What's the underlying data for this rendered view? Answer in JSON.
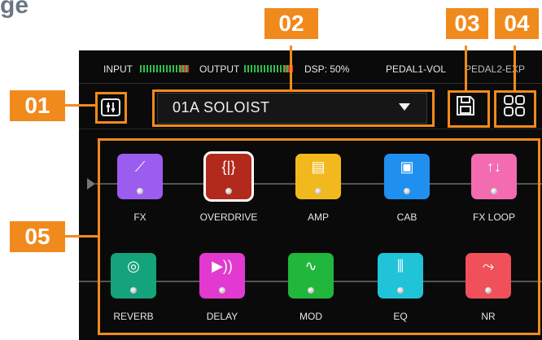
{
  "header_fragment": "ge",
  "status": {
    "input_label": "INPUT",
    "output_label": "OUTPUT",
    "dsp": "DSP: 50%",
    "pedal1": "PEDAL1-VOL",
    "pedal2": "PEDAL2-EXP"
  },
  "preset": {
    "name": "01A  SOLOIST"
  },
  "callouts": [
    "01",
    "02",
    "03",
    "04",
    "05"
  ],
  "pedals_row1": [
    {
      "label": "FX",
      "color": "#9b5cf0",
      "symbol": "⟋"
    },
    {
      "label": "OVERDRIVE",
      "color": "#b22a1c",
      "symbol": "{|}"
    },
    {
      "label": "AMP",
      "color": "#f2b91e",
      "symbol": "▤"
    },
    {
      "label": "CAB",
      "color": "#1f8ff0",
      "symbol": "▣"
    },
    {
      "label": "FX LOOP",
      "color": "#f36bb0",
      "symbol": "↑↓"
    }
  ],
  "pedals_row2": [
    {
      "label": "REVERB",
      "color": "#15a37c",
      "symbol": "◎"
    },
    {
      "label": "DELAY",
      "color": "#e23ad0",
      "symbol": "▶))"
    },
    {
      "label": "MOD",
      "color": "#21b63c",
      "symbol": "∿"
    },
    {
      "label": "EQ",
      "color": "#20c3d8",
      "symbol": "⫼"
    },
    {
      "label": "NR",
      "color": "#f0505a",
      "symbol": "⤳"
    }
  ],
  "colors": {
    "accent": "#f18a1c",
    "screen": "#0a0a0a"
  }
}
